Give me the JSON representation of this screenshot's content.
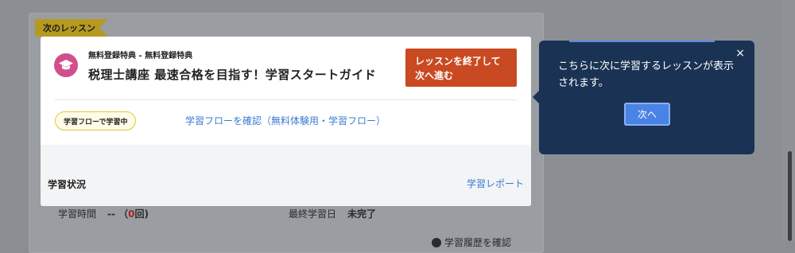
{
  "ribbon": {
    "label": "次のレッスン"
  },
  "lesson": {
    "breadcrumb": "無料登録特典 - 無料登録特典",
    "title": "税理士講座 最速合格を目指す！学習スタートガイド",
    "end_button_label": "レッスンを終了して次へ進む",
    "flow_badge": "学習フローで学習中",
    "flow_link": "学習フローを確認（無料体験用・学習フロー）"
  },
  "status": {
    "title": "学習状況",
    "report_link": "学習レポート",
    "study_time_label": "学習時間",
    "study_time_value": "--",
    "study_count_open": "（",
    "study_count": "0",
    "study_count_close": "回)",
    "last_date_label": "最終学習日",
    "last_date_value": "未完了"
  },
  "history": {
    "label": "学習履歴を確認"
  },
  "tooltip": {
    "message": "こちらに次に学習するレッスンが表示されます。",
    "close_label": "×",
    "next_label": "次へ"
  },
  "colors": {
    "ribbon": "#b59a1f",
    "end_button": "#c94a22",
    "link": "#3c7bd1",
    "tooltip_bg": "#1a3354",
    "next_button": "#4a83e6",
    "icon_bg": "#d24f8c"
  },
  "icons": {
    "lesson": "graduation-cap-icon",
    "close": "close-icon",
    "history": "history-icon"
  }
}
